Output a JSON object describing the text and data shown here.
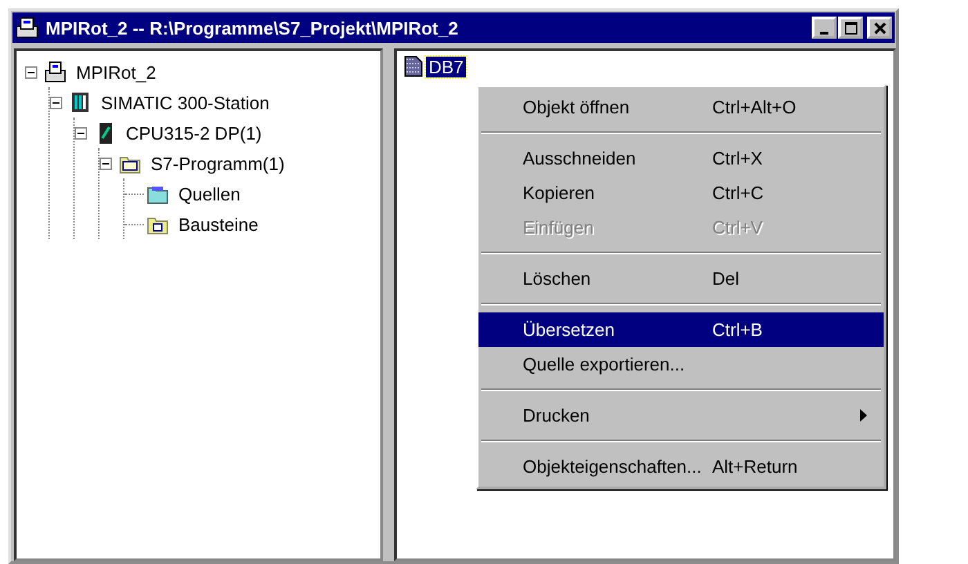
{
  "window": {
    "title": "MPIRot_2 -- R:\\Programme\\S7_Projekt\\MPIRot_2"
  },
  "tree": [
    {
      "label": "MPIRot_2",
      "kind": "project",
      "expanded": true,
      "children": [
        {
          "label": "SIMATIC 300-Station",
          "kind": "station",
          "expanded": true,
          "children": [
            {
              "label": "CPU315-2 DP(1)",
              "kind": "cpu",
              "expanded": true,
              "children": [
                {
                  "label": "S7-Programm(1)",
                  "kind": "program",
                  "expanded": true,
                  "children": [
                    {
                      "label": "Quellen",
                      "kind": "sources"
                    },
                    {
                      "label": "Bausteine",
                      "kind": "blocks"
                    }
                  ]
                }
              ]
            }
          ]
        }
      ]
    }
  ],
  "objects": [
    {
      "label": "DB7",
      "selected": true
    }
  ],
  "context_menu": [
    {
      "kind": "item",
      "label": "Objekt öffnen",
      "shortcut": "Ctrl+Alt+O",
      "disabled": false,
      "selected": false
    },
    {
      "kind": "separator"
    },
    {
      "kind": "item",
      "label": "Ausschneiden",
      "shortcut": "Ctrl+X",
      "disabled": false,
      "selected": false
    },
    {
      "kind": "item",
      "label": "Kopieren",
      "shortcut": "Ctrl+C",
      "disabled": false,
      "selected": false
    },
    {
      "kind": "item",
      "label": "Einfügen",
      "shortcut": "Ctrl+V",
      "disabled": true,
      "selected": false
    },
    {
      "kind": "separator"
    },
    {
      "kind": "item",
      "label": "Löschen",
      "shortcut": "Del",
      "disabled": false,
      "selected": false
    },
    {
      "kind": "separator"
    },
    {
      "kind": "item",
      "label": "Übersetzen",
      "shortcut": "Ctrl+B",
      "disabled": false,
      "selected": true
    },
    {
      "kind": "item",
      "label": "Quelle exportieren...",
      "disabled": false,
      "selected": false
    },
    {
      "kind": "separator"
    },
    {
      "kind": "item",
      "label": "Drucken",
      "submenu": true,
      "disabled": false,
      "selected": false
    },
    {
      "kind": "separator"
    },
    {
      "kind": "item",
      "label": "Objekteigenschaften...",
      "shortcut": "Alt+Return",
      "disabled": false,
      "selected": false
    }
  ]
}
